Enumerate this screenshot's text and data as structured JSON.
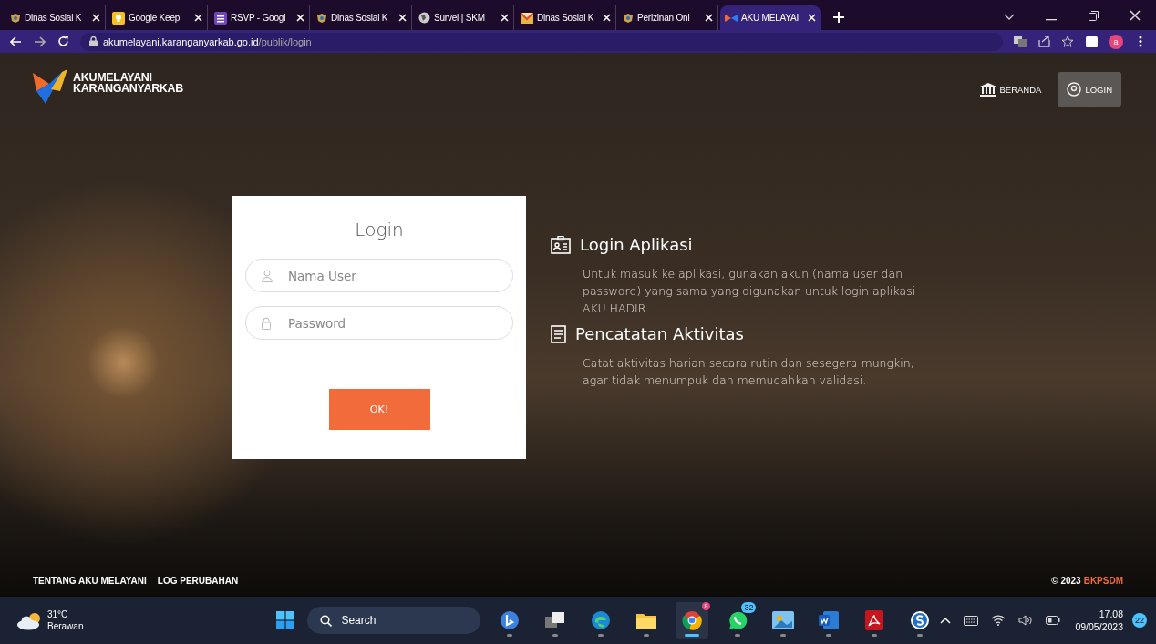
{
  "browser": {
    "tabs": [
      {
        "title": "Dinas Sosial K",
        "kind": "crest",
        "selected": false
      },
      {
        "title": "Google Keep",
        "kind": "keep",
        "selected": false
      },
      {
        "title": "RSVP - Googl",
        "kind": "form",
        "selected": false
      },
      {
        "title": "Dinas Sosial K",
        "kind": "crest",
        "selected": false
      },
      {
        "title": "Survei | SKM",
        "kind": "globe",
        "selected": false
      },
      {
        "title": "Dinas Sosial K",
        "kind": "mail",
        "selected": false
      },
      {
        "title": "Perizinan Onl",
        "kind": "crest",
        "selected": false
      },
      {
        "title": "AKU MELAYAI",
        "kind": "bowtie",
        "selected": true
      }
    ],
    "address": {
      "host": "akumelayani.karanganyarkab.go.id",
      "path": "/publik/login"
    },
    "profile": "a"
  },
  "header": {
    "logo_line_1": "AKUMELAYANI",
    "logo_line_2": "KARANGANYARKAB",
    "nav": [
      {
        "label": "BERANDA",
        "kind": "bank",
        "selected": false
      },
      {
        "label": "LOGIN",
        "kind": "user",
        "selected": true
      }
    ]
  },
  "login": {
    "title": "Login",
    "fields": [
      {
        "placeholder": "Nama User",
        "kind": "user"
      },
      {
        "placeholder": "Password",
        "kind": "lock"
      }
    ],
    "button": "OK!"
  },
  "info": [
    {
      "kind": "id-card",
      "title": "Login Aplikasi",
      "text": "Untuk masuk ke aplikasi, gunakan akun (nama user dan password) yang sama yang digunakan untuk login aplikasi AKU HADIR."
    },
    {
      "kind": "document",
      "title": "Pencatatan Aktivitas",
      "text": "Catat aktivitas harian secara rutin dan sesegera mungkin, agar tidak menumpuk dan memudahkan validasi."
    }
  ],
  "footer": {
    "links": [
      "TENTANG AKU MELAYANI",
      "LOG PERUBAHAN"
    ],
    "copyright": "© 2023",
    "owner": "BKPSDM"
  },
  "taskbar": {
    "weather": {
      "temp": "31°C",
      "condition": "Berawan"
    },
    "search": "Search",
    "apps": [
      {
        "kind": "bing",
        "selected": false
      },
      {
        "kind": "taskview",
        "selected": false
      },
      {
        "kind": "edge",
        "selected": false
      },
      {
        "kind": "folder",
        "selected": false
      },
      {
        "kind": "chrome",
        "selected": true,
        "badge": "8"
      },
      {
        "kind": "whatsapp",
        "selected": false,
        "badge": "32"
      },
      {
        "kind": "photos",
        "selected": false
      },
      {
        "kind": "word",
        "selected": false
      },
      {
        "kind": "pdf",
        "selected": false
      },
      {
        "kind": "app",
        "selected": false
      }
    ],
    "time": "17.08",
    "date": "09/05/2023",
    "notifications": "22"
  }
}
